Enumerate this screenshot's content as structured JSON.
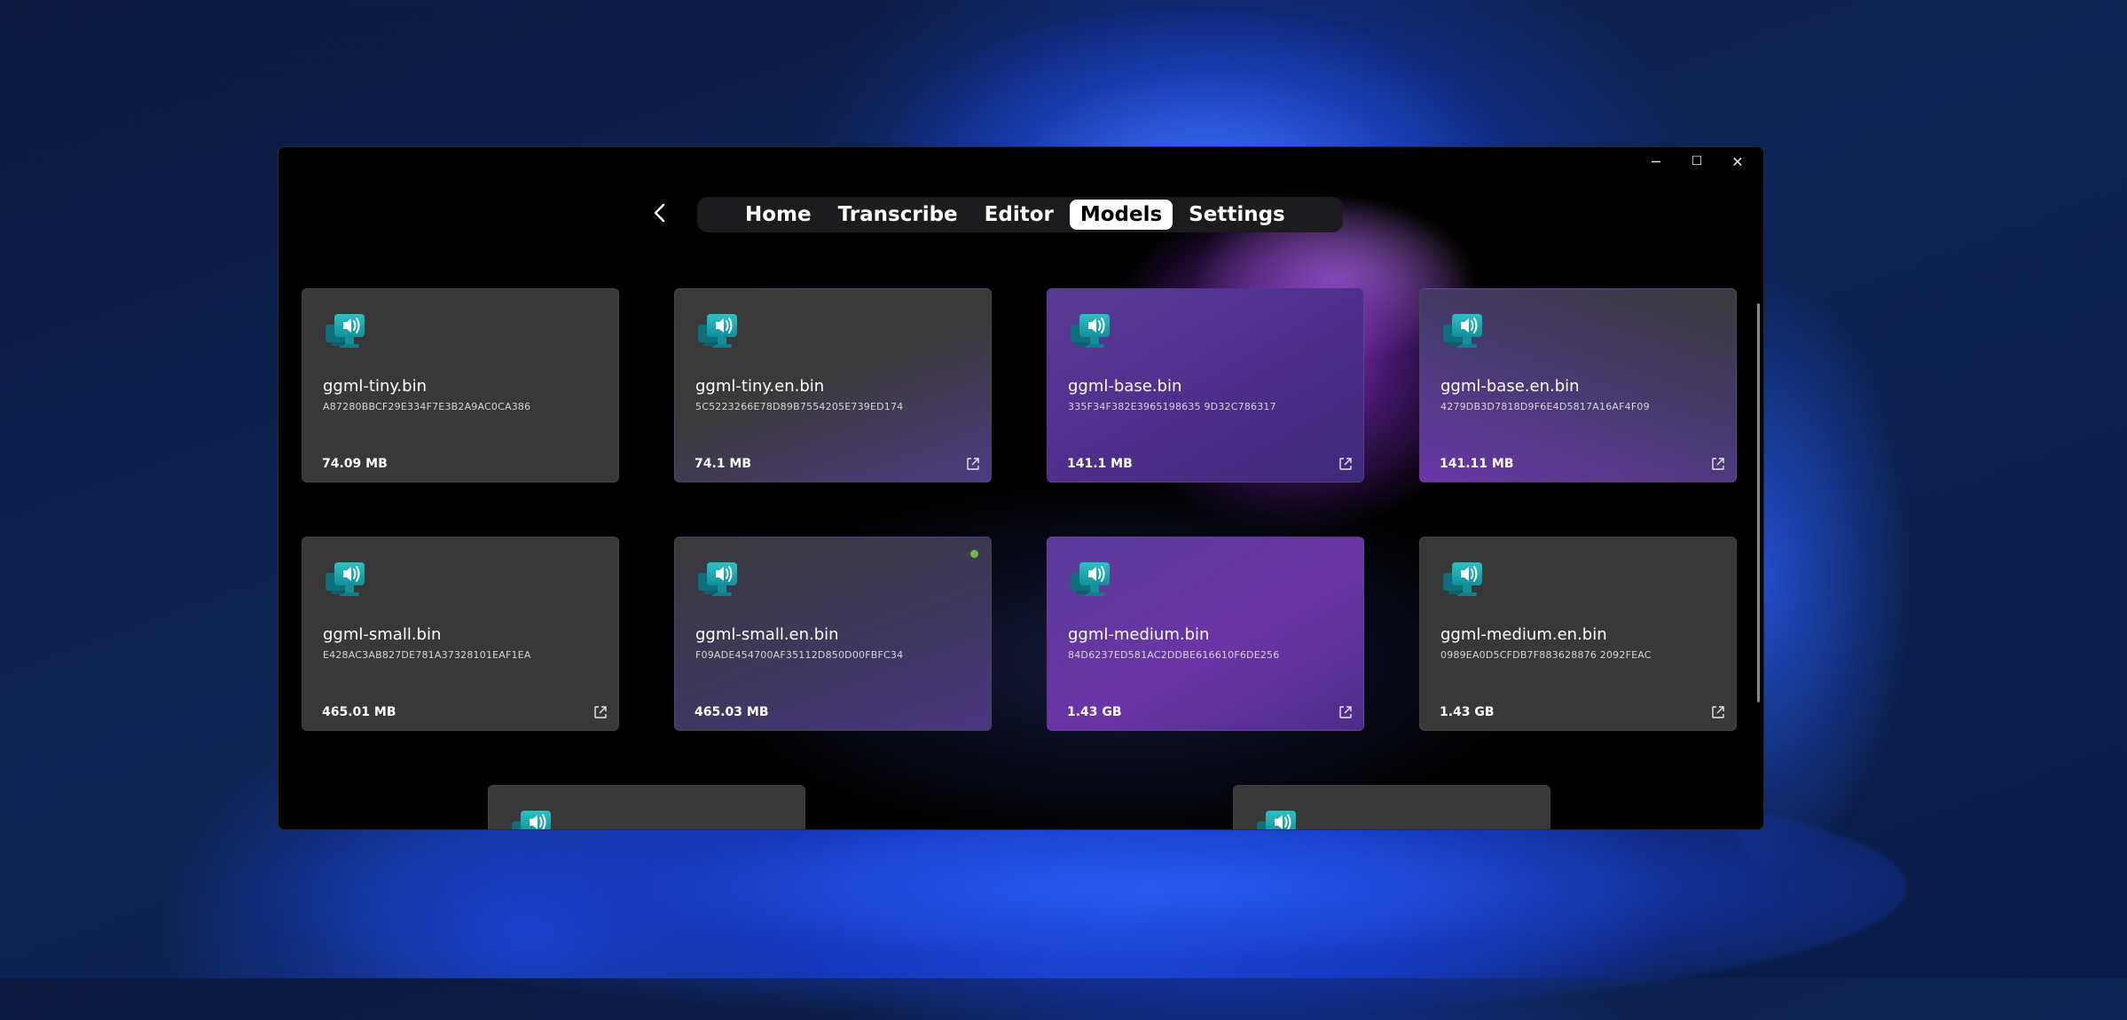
{
  "window": {
    "caption": {
      "minimize": "─",
      "maximize": "☐",
      "close": "✕"
    }
  },
  "nav": {
    "tabs": [
      {
        "label": "Home",
        "active": false
      },
      {
        "label": "Transcribe",
        "active": false
      },
      {
        "label": "Editor",
        "active": false
      },
      {
        "label": "Models",
        "active": true
      },
      {
        "label": "Settings",
        "active": false
      }
    ]
  },
  "models": [
    {
      "name": "ggml-tiny.bin",
      "hash": "A87280BBCF29E334F7E3B2A9AC0CA386",
      "size": "74.09 MB",
      "open_link": false,
      "selected": false
    },
    {
      "name": "ggml-tiny.en.bin",
      "hash": "5C5223266E78D89B7554205E739ED174",
      "size": "74.1 MB",
      "open_link": true,
      "selected": false
    },
    {
      "name": "ggml-base.bin",
      "hash": "335F34F382E3965198635 9D32C786317",
      "size": "141.1 MB",
      "open_link": true,
      "selected": false
    },
    {
      "name": "ggml-base.en.bin",
      "hash": "4279DB3D7818D9F6E4D5817A16AF4F09",
      "size": "141.11 MB",
      "open_link": true,
      "selected": false
    },
    {
      "name": "ggml-small.bin",
      "hash": "E428AC3AB827DE781A37328101EAF1EA",
      "size": "465.01 MB",
      "open_link": true,
      "selected": false
    },
    {
      "name": "ggml-small.en.bin",
      "hash": "F09ADE454700AF35112D850D00FBFC34",
      "size": "465.03 MB",
      "open_link": false,
      "selected": true
    },
    {
      "name": "ggml-medium.bin",
      "hash": "84D6237ED581AC2DDBE616610F6DE256",
      "size": "1.43 GB",
      "open_link": true,
      "selected": false
    },
    {
      "name": "ggml-medium.en.bin",
      "hash": "0989EA0D5CFDB7F883628876 2092FEAC",
      "size": "1.43 GB",
      "open_link": true,
      "selected": false
    }
  ],
  "colors": {
    "accent": "#ffffff",
    "status_active": "#6cc04a",
    "card_gray": "#383838",
    "card_purple": "#5a3a95"
  },
  "icons": {
    "model": "speaker-monitor-icon",
    "open": "open-external-icon",
    "back": "chevron-left-icon"
  }
}
